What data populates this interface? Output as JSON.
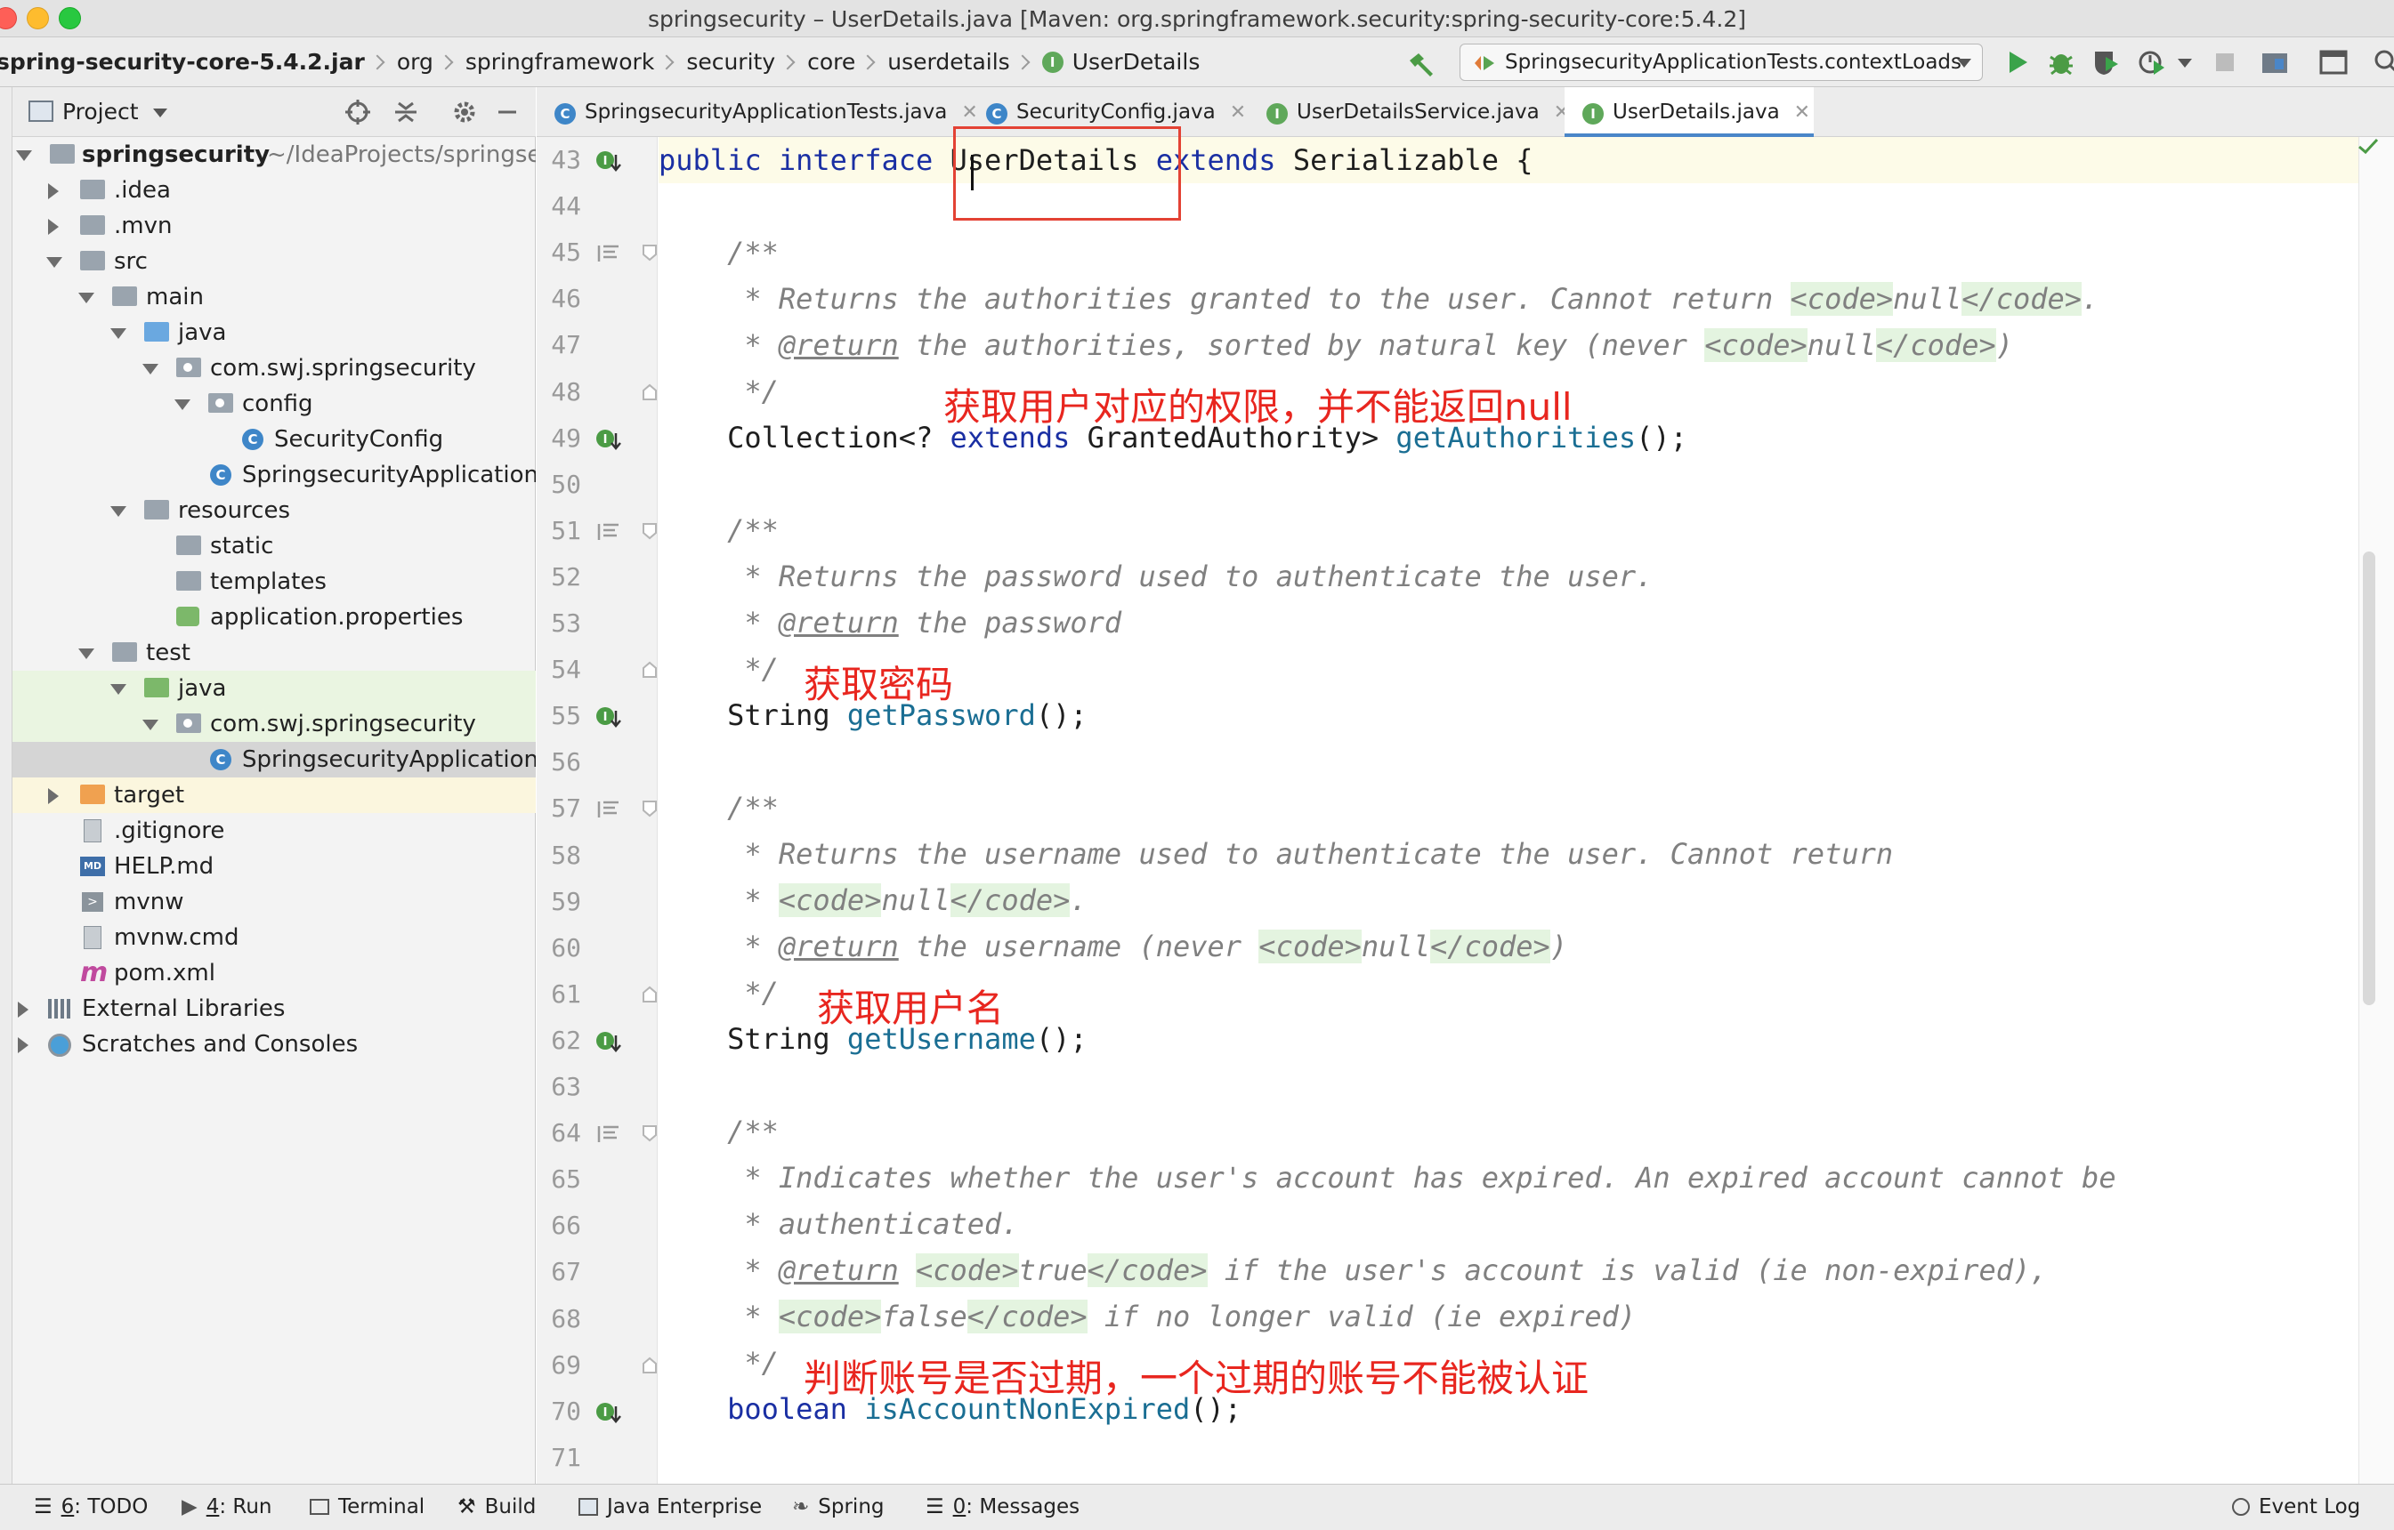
{
  "window": {
    "title": "springsecurity – UserDetails.java [Maven: org.springframework.security:spring-security-core:5.4.2]"
  },
  "navbar": {
    "breadcrumbs": [
      "spring-security-core-5.4.2.jar",
      "org",
      "springframework",
      "security",
      "core",
      "userdetails",
      "UserDetails"
    ],
    "run_config": "SpringsecurityApplicationTests.contextLoads"
  },
  "project_panel": {
    "title": "Project",
    "tree": [
      {
        "label": "springsecurity",
        "suffix": "~/IdeaProjects/springse"
      },
      {
        "label": ".idea"
      },
      {
        "label": ".mvn"
      },
      {
        "label": "src"
      },
      {
        "label": "main"
      },
      {
        "label": "java"
      },
      {
        "label": "com.swj.springsecurity"
      },
      {
        "label": "config"
      },
      {
        "label": "SecurityConfig"
      },
      {
        "label": "SpringsecurityApplication"
      },
      {
        "label": "resources"
      },
      {
        "label": "static"
      },
      {
        "label": "templates"
      },
      {
        "label": "application.properties"
      },
      {
        "label": "test"
      },
      {
        "label": "java"
      },
      {
        "label": "com.swj.springsecurity"
      },
      {
        "label": "SpringsecurityApplication"
      },
      {
        "label": "target"
      },
      {
        "label": ".gitignore"
      },
      {
        "label": "HELP.md"
      },
      {
        "label": "mvnw"
      },
      {
        "label": "mvnw.cmd"
      },
      {
        "label": "pom.xml"
      },
      {
        "label": "External Libraries"
      },
      {
        "label": "Scratches and Consoles"
      }
    ]
  },
  "tabs": [
    {
      "label": "SpringsecurityApplicationTests.java"
    },
    {
      "label": "SecurityConfig.java"
    },
    {
      "label": "UserDetailsService.java"
    },
    {
      "label": "UserDetails.java"
    }
  ],
  "code": {
    "line_numbers": [
      "43",
      "44",
      "45",
      "46",
      "47",
      "48",
      "49",
      "50",
      "51",
      "52",
      "53",
      "54",
      "55",
      "56",
      "57",
      "58",
      "59",
      "60",
      "61",
      "62",
      "63",
      "64",
      "65",
      "66",
      "67",
      "68",
      "69",
      "70",
      "71"
    ],
    "l43": {
      "public": "public",
      "interface": "interface",
      "name": "UserDetails",
      "extends": "extends",
      "rest": "Serializable {"
    },
    "c_open": "/**",
    "c_close": "*/",
    "star": "*",
    "tag_code_open": "<code>",
    "tag_code_close": "</code>",
    "return_tag": "@return",
    "null": "null",
    "l46": {
      "text": "Returns the authorities granted to the user. Cannot return ",
      "end": "."
    },
    "l47": {
      "text": "the authorities, sorted by natural key (never ",
      "end": ")"
    },
    "l49": {
      "pre": "Collection<? ",
      "extends": "extends",
      "mid": " GrantedAuthority> ",
      "method": "getAuthorities",
      "end": "();"
    },
    "l52": {
      "text": "Returns the password used to authenticate the user."
    },
    "l53": {
      "text": "the password"
    },
    "l55": {
      "type": "String ",
      "method": "getPassword",
      "end": "();"
    },
    "l58": {
      "text": "Returns the username used to authenticate the user. Cannot return"
    },
    "l59": {
      "end": "."
    },
    "l60": {
      "text": "the username (never ",
      "end": ")"
    },
    "l62": {
      "type": "String ",
      "method": "getUsername",
      "end": "();"
    },
    "l65": {
      "text": "Indicates whether the user's account has expired. An expired account cannot be"
    },
    "l66": {
      "text": "authenticated."
    },
    "l67": {
      "true": "true",
      "text": " if the user's account is valid (ie non-expired),"
    },
    "l68": {
      "false": "false",
      "text": " if no longer valid (ie expired)"
    },
    "l70": {
      "boolean": "boolean",
      "method": "isAccountNonExpired",
      "end": "();"
    }
  },
  "annotations": {
    "authorities": "获取用户对应的权限，并不能返回null",
    "password": "获取密码",
    "username": "获取用户名",
    "expired": "判断账号是否过期，一个过期的账号不能被认证"
  },
  "bottom_bar": {
    "todo": {
      "key": "6",
      "label": ": TODO"
    },
    "run": {
      "key": "4",
      "label": ": Run"
    },
    "terminal": "Terminal",
    "build": "Build",
    "java_enterprise": "Java Enterprise",
    "spring": "Spring",
    "messages": {
      "key": "0",
      "label": ": Messages"
    },
    "event_log": "Event Log"
  },
  "colors": {
    "keyword": "#1a2fa3",
    "comment": "#808080",
    "annotation": "#e8261f",
    "highlight_box": "#e34234"
  }
}
